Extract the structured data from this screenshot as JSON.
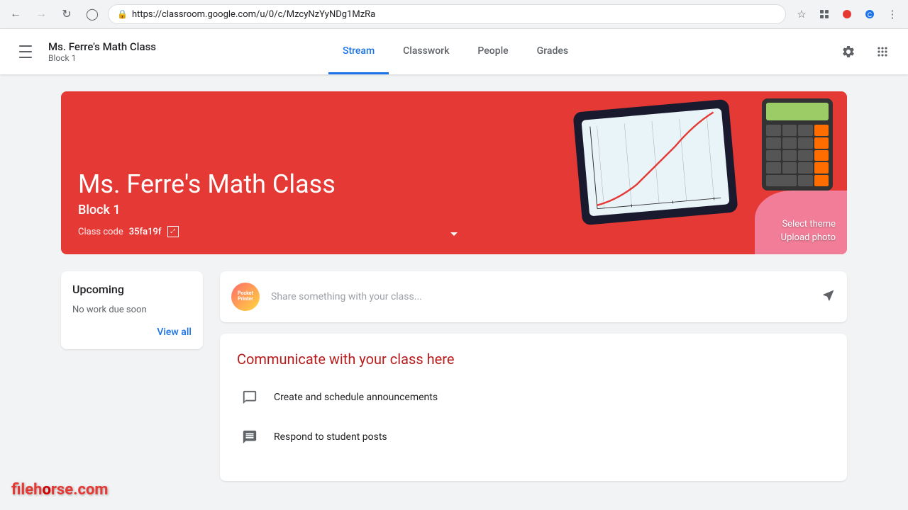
{
  "browser": {
    "url": "https://classroom.google.com/u/0/c/MzcyNzYyNDg1MzRa",
    "back_disabled": false,
    "forward_disabled": true
  },
  "header": {
    "menu_label": "☰",
    "class_title": "Ms. Ferre's Math Class",
    "class_subtitle": "Block 1",
    "nav_tabs": [
      {
        "id": "stream",
        "label": "Stream",
        "active": true
      },
      {
        "id": "classwork",
        "label": "Classwork",
        "active": false
      },
      {
        "id": "people",
        "label": "People",
        "active": false
      },
      {
        "id": "grades",
        "label": "Grades",
        "active": false
      }
    ],
    "settings_icon": "⚙",
    "apps_icon": "⠿"
  },
  "banner": {
    "class_name": "Ms. Ferre's Math Class",
    "block": "Block 1",
    "code_label": "Class code",
    "code_value": "35fa19f",
    "select_theme": "Select theme",
    "upload_photo": "Upload photo",
    "chevron": "⌄"
  },
  "sidebar": {
    "upcoming_title": "Upcoming",
    "no_work_text": "No work due soon",
    "view_all_label": "View all"
  },
  "feed": {
    "share_placeholder": "Share something with your class...",
    "communicate_title": "Communicate with your class here",
    "communicate_items": [
      {
        "icon": "□",
        "text": "Create and schedule announcements"
      },
      {
        "icon": "≡",
        "text": "Respond to student posts"
      }
    ]
  },
  "watermark": {
    "prefix": "fileh",
    "highlight": "o",
    "suffix": "rse",
    "domain": ".com"
  }
}
